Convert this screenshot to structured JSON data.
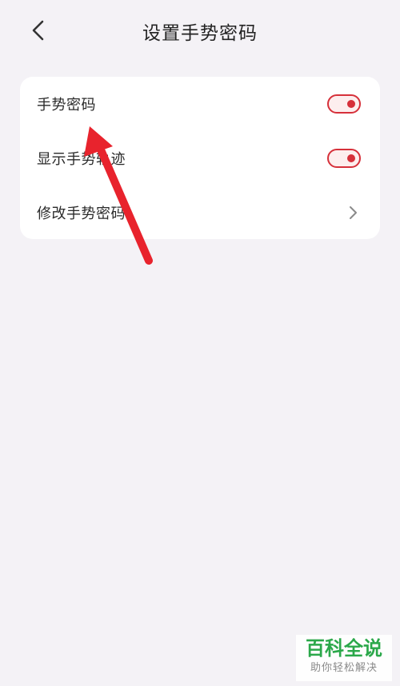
{
  "header": {
    "title": "设置手势密码",
    "back_icon": "chevron-left-icon"
  },
  "settings": {
    "items": [
      {
        "label": "手势密码",
        "control": "toggle",
        "on": true
      },
      {
        "label": "显示手势轨迹",
        "control": "toggle",
        "on": true
      },
      {
        "label": "修改手势密码",
        "control": "chevron"
      }
    ]
  },
  "annotation": {
    "type": "arrow",
    "color": "#e8232d"
  },
  "watermark": {
    "title": "百科全说",
    "subtitle": "助你轻松解决"
  },
  "colors": {
    "background": "#f4f2f6",
    "accent": "#d6303a",
    "brand_green": "#2ba84a"
  }
}
